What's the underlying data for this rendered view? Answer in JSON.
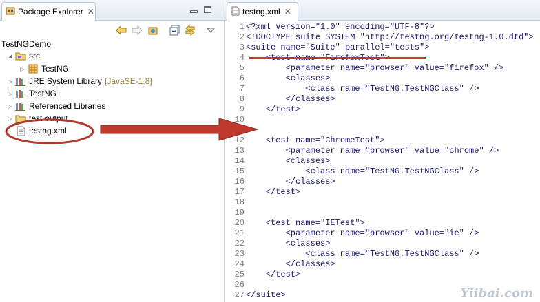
{
  "package_explorer": {
    "tab_label": "Package Explorer",
    "tab_close": "✕",
    "project": "TestNGDemo",
    "tree": [
      {
        "label": "src",
        "depth": 1,
        "expanded": true,
        "icon": "source-folder-icon"
      },
      {
        "label": "TestNG",
        "depth": 2,
        "expanded": false,
        "icon": "package-icon"
      },
      {
        "label": "JRE System Library",
        "decoration": "[JavaSE-1.8]",
        "depth": 1,
        "expanded": false,
        "icon": "library-icon"
      },
      {
        "label": "TestNG",
        "depth": 1,
        "expanded": false,
        "icon": "library-icon"
      },
      {
        "label": "Referenced Libraries",
        "depth": 1,
        "expanded": false,
        "icon": "library-icon"
      },
      {
        "label": "test-output",
        "depth": 1,
        "expanded": false,
        "icon": "folder-icon"
      },
      {
        "label": "testng.xml",
        "depth": 1,
        "expanded": null,
        "icon": "xml-file-icon",
        "highlighted": true
      }
    ]
  },
  "editor": {
    "tab_label": "testng.xml",
    "tab_close": "✕",
    "lines": [
      {
        "n": "1",
        "text": "<?xml version=\"1.0\" encoding=\"UTF-8\"?>"
      },
      {
        "n": "2",
        "text": "<!DOCTYPE suite SYSTEM \"http://testng.org/testng-1.0.dtd\">"
      },
      {
        "n": "3",
        "text": "<suite name=\"Suite\" parallel=\"tests\">"
      },
      {
        "n": "4",
        "text": "    <test name=\"FirefoxTest\">"
      },
      {
        "n": "5",
        "text": "        <parameter name=\"browser\" value=\"firefox\" />"
      },
      {
        "n": "6",
        "text": "        <classes>"
      },
      {
        "n": "7",
        "text": "            <class name=\"TestNG.TestNGClass\" />"
      },
      {
        "n": "8",
        "text": "        </classes>"
      },
      {
        "n": "9",
        "text": "    </test>"
      },
      {
        "n": "10",
        "text": ""
      },
      {
        "n": "11",
        "text": ""
      },
      {
        "n": "12",
        "text": "    <test name=\"ChromeTest\">"
      },
      {
        "n": "13",
        "text": "        <parameter name=\"browser\" value=\"chrome\" />"
      },
      {
        "n": "14",
        "text": "        <classes>"
      },
      {
        "n": "15",
        "text": "            <class name=\"TestNG.TestNGClass\" />"
      },
      {
        "n": "16",
        "text": "        </classes>"
      },
      {
        "n": "17",
        "text": "    </test>"
      },
      {
        "n": "18",
        "text": ""
      },
      {
        "n": "19",
        "text": ""
      },
      {
        "n": "20",
        "text": "    <test name=\"IETest\">"
      },
      {
        "n": "21",
        "text": "        <parameter name=\"browser\" value=\"ie\" />"
      },
      {
        "n": "22",
        "text": "        <classes>"
      },
      {
        "n": "23",
        "text": "            <class name=\"TestNG.TestNGClass\" />"
      },
      {
        "n": "24",
        "text": "        </classes>"
      },
      {
        "n": "25",
        "text": "    </test>"
      },
      {
        "n": "26",
        "text": ""
      },
      {
        "n": "27",
        "text": "</suite>"
      }
    ]
  },
  "watermark": "Yiibai.com",
  "colors": {
    "annotation_red": "#c0392b",
    "line_number": "#7d7d7d",
    "code_text": "#1a1a6b",
    "decoration": "#9d7f3a"
  }
}
